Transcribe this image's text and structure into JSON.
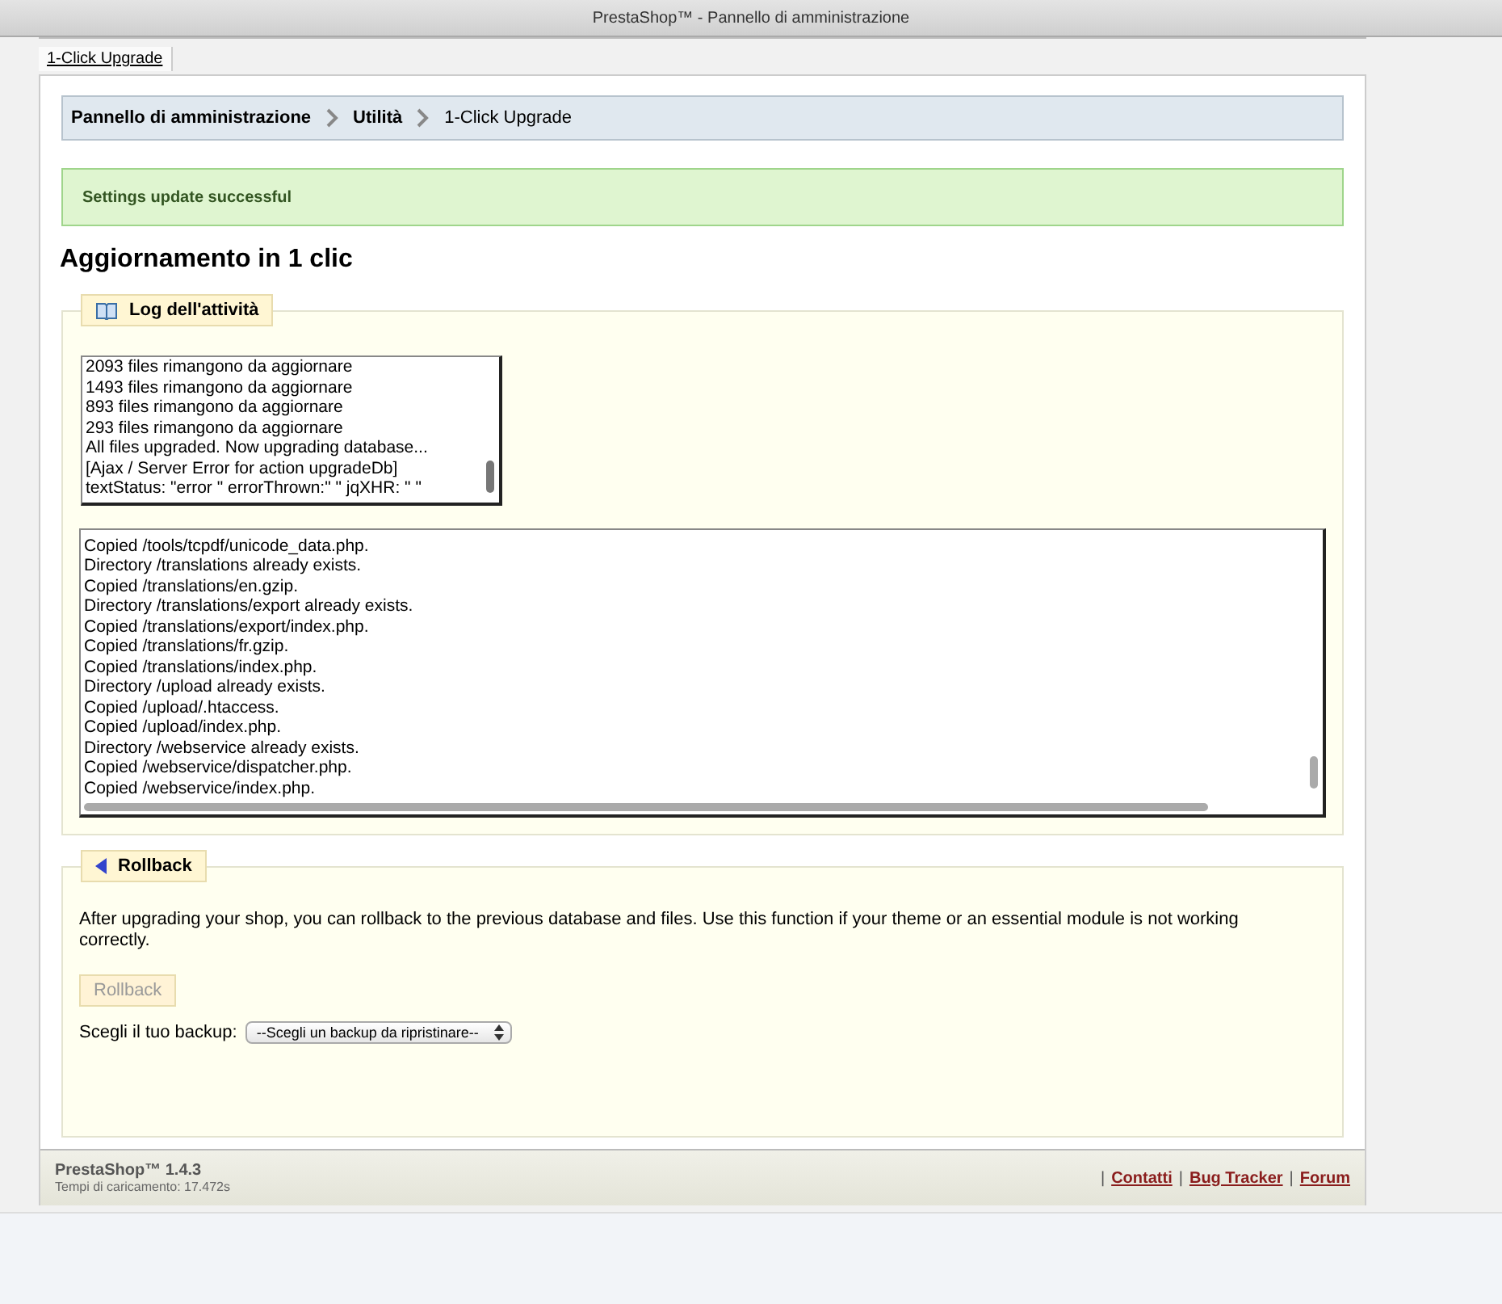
{
  "window": {
    "title": "PrestaShop™ - Pannello di amministrazione"
  },
  "tabs": [
    {
      "label": "1-Click Upgrade",
      "selected": true
    }
  ],
  "breadcrumb": [
    {
      "label": "Pannello di amministrazione",
      "bold": true
    },
    {
      "label": "Utilità",
      "bold": true
    },
    {
      "label": "1-Click Upgrade",
      "bold": false
    }
  ],
  "success_message": "Settings update successful",
  "heading": "Aggiornamento in 1 clic",
  "activity_log": {
    "legend": "Log dell'attività",
    "progress_lines": [
      "2093 files rimangono da aggiornare",
      "1493 files rimangono da aggiornare",
      "893 files rimangono da aggiornare",
      "293 files rimangono da aggiornare",
      "All files upgraded. Now upgrading database...",
      "[Ajax / Server Error for action upgradeDb]",
      "textStatus: \"error \" errorThrown:\" \" jqXHR: \" \""
    ],
    "detail_lines": [
      "Copied /tools/tcpdf/unicode_data.php.",
      "Directory /translations already exists.",
      "Copied /translations/en.gzip.",
      "Directory /translations/export already exists.",
      "Copied /translations/export/index.php.",
      "Copied /translations/fr.gzip.",
      "Copied /translations/index.php.",
      "Directory /upload already exists.",
      "Copied /upload/.htaccess.",
      "Copied /upload/index.php.",
      "Directory /webservice already exists.",
      "Copied /webservice/dispatcher.php.",
      "Copied /webservice/index.php."
    ]
  },
  "rollback": {
    "legend": "Rollback",
    "description": "After upgrading your shop, you can rollback to the previous database and files. Use this function if your theme or an essential module is not working correctly.",
    "button": {
      "label": "Rollback",
      "disabled": true
    },
    "backup_label": "Scegli il tuo backup:",
    "backup_select": "--Scegli un backup da ripristinare--"
  },
  "footer": {
    "version": "PrestaShop™ 1.4.3",
    "load_time": "Tempi di caricamento: 17.472s",
    "items": [
      {
        "kind": "separator",
        "text": "|"
      },
      {
        "kind": "link",
        "text": "Contatti"
      },
      {
        "kind": "separator",
        "text": "|"
      },
      {
        "kind": "link",
        "text": "Bug Tracker"
      },
      {
        "kind": "separator",
        "text": "|"
      },
      {
        "kind": "link",
        "text": "Forum"
      }
    ]
  }
}
